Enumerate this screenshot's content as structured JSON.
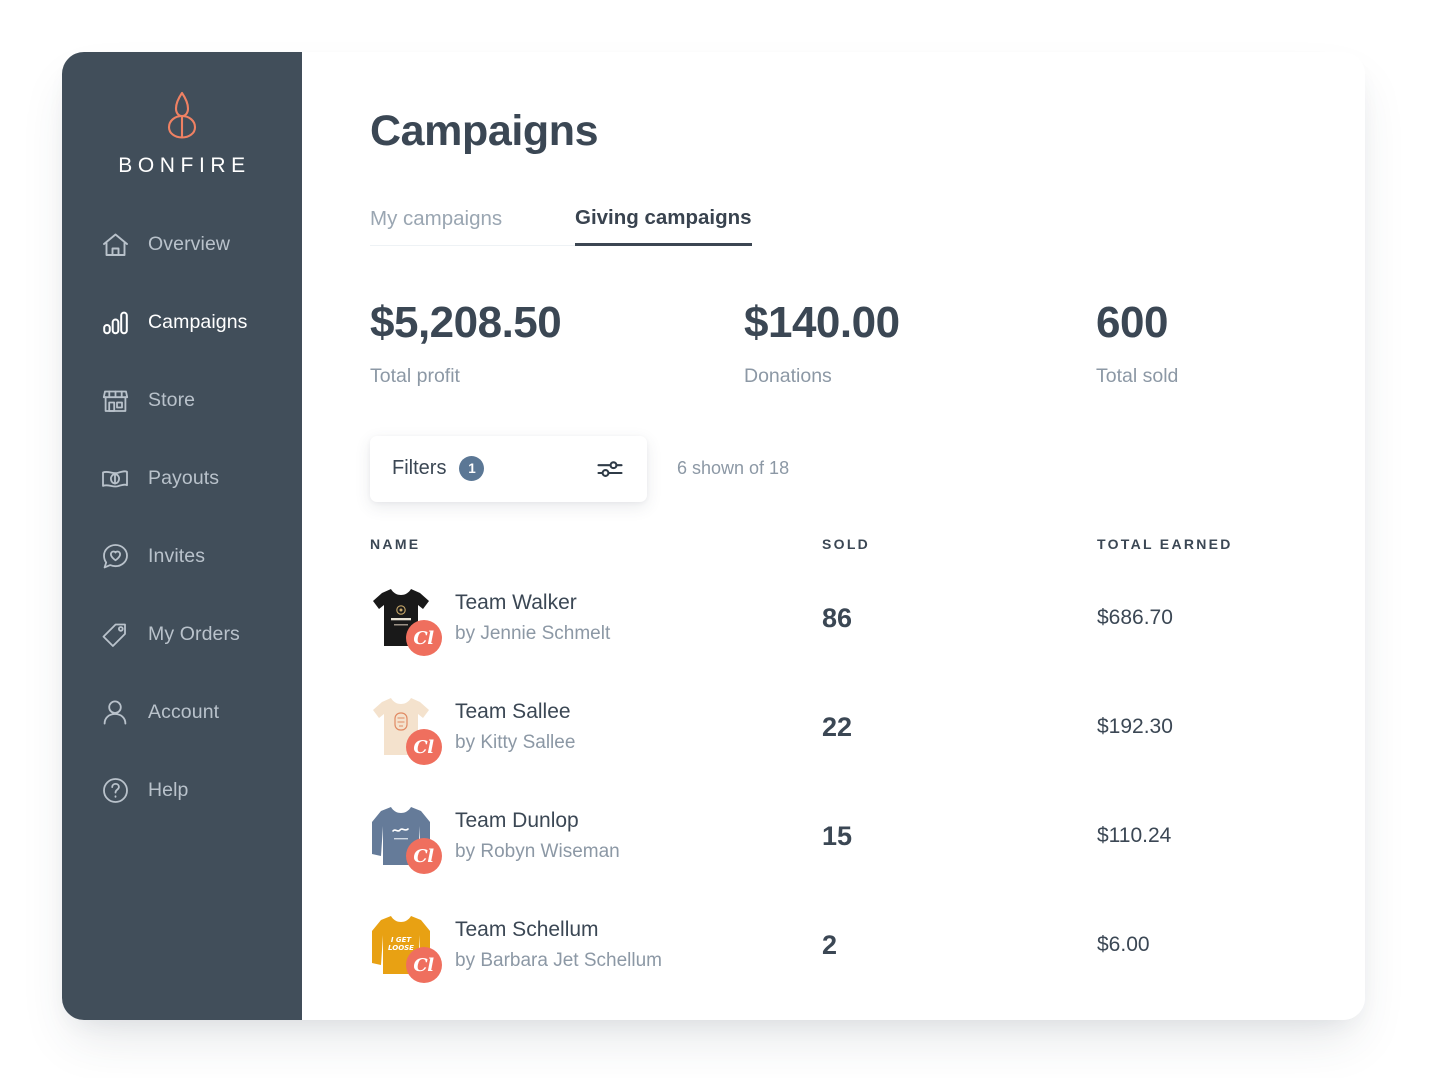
{
  "brand": {
    "name": "BONFIRE",
    "logo_icon": "bonfire-flame-logo",
    "accent_color": "#ef6f5e",
    "sidebar_color": "#414e5a"
  },
  "sidebar": {
    "items": [
      {
        "label": "Overview",
        "icon": "home-icon",
        "active": false
      },
      {
        "label": "Campaigns",
        "icon": "bar-chart-icon",
        "active": true
      },
      {
        "label": "Store",
        "icon": "storefront-icon",
        "active": false
      },
      {
        "label": "Payouts",
        "icon": "money-bill-icon",
        "active": false
      },
      {
        "label": "Invites",
        "icon": "heart-chat-icon",
        "active": false
      },
      {
        "label": "My Orders",
        "icon": "tag-icon",
        "active": false
      },
      {
        "label": "Account",
        "icon": "user-icon",
        "active": false
      },
      {
        "label": "Help",
        "icon": "question-circle-icon",
        "active": false
      }
    ]
  },
  "header": {
    "title": "Campaigns"
  },
  "tabs": [
    {
      "label": "My campaigns",
      "active": false
    },
    {
      "label": "Giving campaigns",
      "active": true
    }
  ],
  "stats": [
    {
      "value": "$5,208.50",
      "label": "Total profit"
    },
    {
      "value": "$140.00",
      "label": "Donations"
    },
    {
      "value": "600",
      "label": "Total sold"
    }
  ],
  "filters": {
    "label": "Filters",
    "badge_count": "1",
    "badge_color": "#5b7795",
    "icon": "sliders-icon",
    "shown_count_text": "6 shown of 18"
  },
  "table": {
    "columns": [
      "NAME",
      "SOLD",
      "TOTAL EARNED"
    ],
    "rows": [
      {
        "name": "Team Walker",
        "by": "by Jennie Schmelt",
        "sold": "86",
        "earned": "$686.70",
        "thumb_type": "tee",
        "thumb_color": "#191919",
        "thumb_print_color": "#c9a96a",
        "badge_text": "Cl"
      },
      {
        "name": "Team Sallee",
        "by": "by Kitty Sallee",
        "sold": "22",
        "earned": "$192.30",
        "thumb_type": "tee",
        "thumb_color": "#f4e2cd",
        "thumb_print_color": "#e08a63",
        "badge_text": "Cl"
      },
      {
        "name": "Team Dunlop",
        "by": "by Robyn Wiseman",
        "sold": "15",
        "earned": "$110.24",
        "thumb_type": "longsleeve",
        "thumb_color": "#657b99",
        "thumb_print_color": "#ffffff",
        "badge_text": "Cl"
      },
      {
        "name": "Team Schellum",
        "by": "by Barbara Jet Schellum",
        "sold": "2",
        "earned": "$6.00",
        "thumb_type": "longsleeve",
        "thumb_color": "#e8a113",
        "thumb_print_color": "#ffffff",
        "badge_text": "Cl"
      }
    ]
  }
}
